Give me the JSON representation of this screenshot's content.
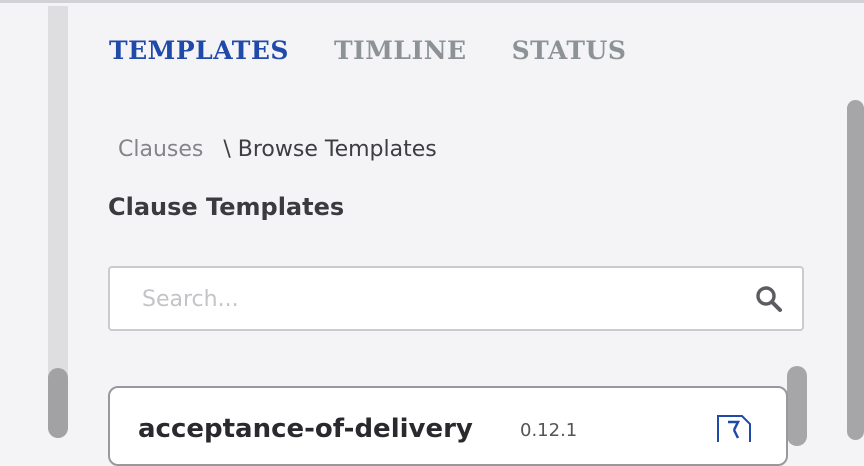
{
  "tabs": [
    {
      "label": "TEMPLATES",
      "active": true
    },
    {
      "label": "TIMLINE",
      "active": false
    },
    {
      "label": "STATUS",
      "active": false
    }
  ],
  "breadcrumb": {
    "link": "Clauses",
    "separator": "\\",
    "current": "Browse Templates"
  },
  "section_title": "Clause Templates",
  "search": {
    "placeholder": "Search...",
    "value": "",
    "icon": "search-icon"
  },
  "templates": [
    {
      "name": "acceptance-of-delivery",
      "version": "0.12.1",
      "icon": "document-icon"
    }
  ],
  "colors": {
    "active_tab": "#1f4aa9",
    "inactive_tab": "#8d9297",
    "background": "#f4f4f6"
  }
}
